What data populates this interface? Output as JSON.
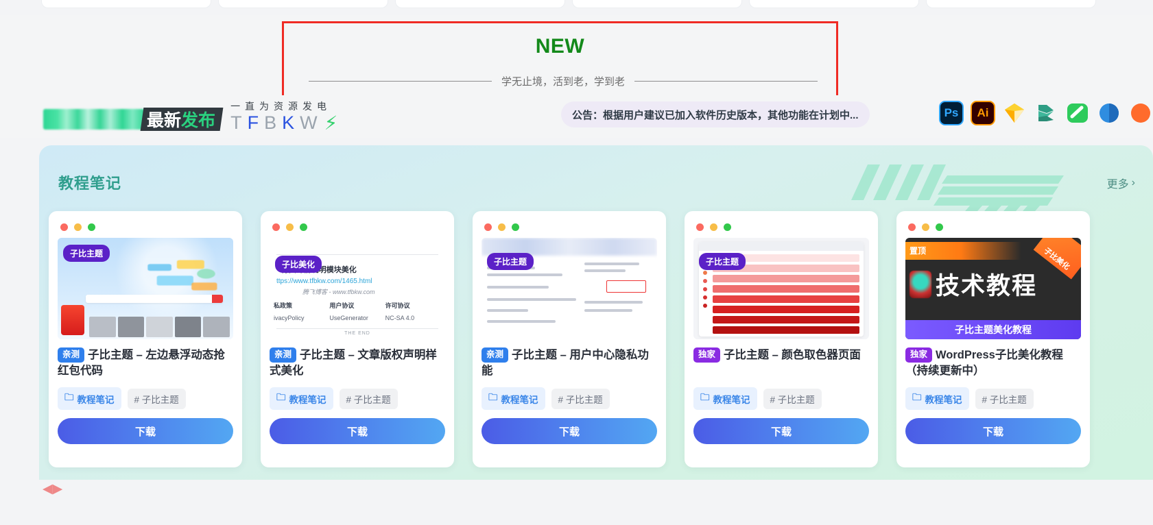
{
  "banner": {
    "title": "NEW",
    "subtitle": "学无止境，活到老，学到老",
    "title_color": "#13891a",
    "highlight_border_color": "#ef2b24"
  },
  "brand": {
    "badge_text_1": "最",
    "badge_text_2": "新",
    "badge_text_3": "发",
    "badge_text_4": "布",
    "slogan_top": "一直为资源发电",
    "slogan_letters": [
      "T",
      "F",
      "B",
      "K",
      "W"
    ],
    "bolt_icon": "⚡"
  },
  "notice": {
    "text": "公告：根据用户建议已加入软件历史版本，其他功能在计划中..."
  },
  "app_icons": [
    {
      "name": "photoshop-icon",
      "label": "Ps"
    },
    {
      "name": "illustrator-icon",
      "label": "Ai"
    },
    {
      "name": "sketch-icon",
      "label": ""
    },
    {
      "name": "xd-icon",
      "label": ""
    },
    {
      "name": "lightroom-icon",
      "label": ""
    },
    {
      "name": "indesign-icon",
      "label": ""
    },
    {
      "name": "more-app-icon",
      "label": ""
    }
  ],
  "section": {
    "title": "教程笔记",
    "more_label": "更多",
    "more_chevron": "›",
    "title_color": "#2f9e8d"
  },
  "cards": [
    {
      "badge": "亲测",
      "badge_type": "blue",
      "title": "子比主题 – 左边悬浮动态抢红包代码",
      "category": "教程笔记",
      "tag": "# 子比主题",
      "button": "下载",
      "thumb_badge": "子比主题"
    },
    {
      "badge": "亲测",
      "badge_type": "blue",
      "title": "子比主题 – 文章版权声明样式美化",
      "category": "教程笔记",
      "tag": "# 子比主题",
      "button": "下载",
      "thumb_badge": "子比美化",
      "thumb_heading": "· 付费详情说明模块美化",
      "thumb_url": "ttps://www.tfbkw.com/1465.html",
      "thumb_brand": "腾飞博客 - www.tfbkw.com",
      "thumb_cols": [
        "私政策",
        "用户协议",
        "许可协议"
      ],
      "thumb_cols2": [
        "ivacyPolicy",
        "UseGenerator",
        "NC-SA 4.0"
      ],
      "thumb_end": "THE END"
    },
    {
      "badge": "亲测",
      "badge_type": "blue",
      "title": "子比主题 – 用户中心隐私功能",
      "category": "教程笔记",
      "tag": "# 子比主题",
      "button": "下载",
      "thumb_badge": "子比主题"
    },
    {
      "badge": "独家",
      "badge_type": "purple",
      "title": "子比主题 – 颜色取色器页面",
      "category": "教程笔记",
      "tag": "# 子比主题",
      "button": "下载",
      "thumb_badge": "子比主题"
    },
    {
      "badge": "独家",
      "badge_type": "purple",
      "title": "WordPress子比美化教程（持续更新中）",
      "category": "教程笔记",
      "tag": "# 子比主题",
      "button": "下载",
      "thumb_pin": "置顶",
      "thumb_big": "技术教程",
      "thumb_footer": "子比主题美化教程",
      "thumb_corner": "子比美化"
    }
  ],
  "icons": {
    "folder": "🗀",
    "bolt": "⚡"
  }
}
